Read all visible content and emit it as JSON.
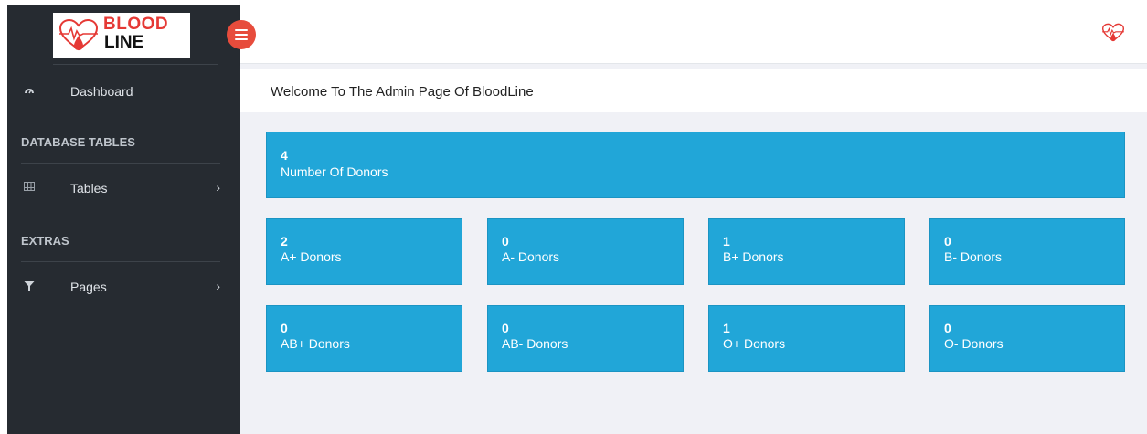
{
  "brand": {
    "line1": "BLOOD",
    "line2": "LINE"
  },
  "sidebar": {
    "dashboard": {
      "label": "Dashboard",
      "icon": "dashboard-icon"
    },
    "sections": [
      {
        "title": "DATABASE TABLES",
        "item": {
          "label": "Tables",
          "icon": "table-icon"
        }
      },
      {
        "title": "EXTRAS",
        "item": {
          "label": "Pages",
          "icon": "funnel-icon"
        }
      }
    ]
  },
  "header": {
    "welcome": "Welcome To The Admin Page Of BloodLine"
  },
  "summary": {
    "value": "4",
    "label": "Number Of Donors"
  },
  "blood_groups": [
    {
      "value": "2",
      "label": "A+ Donors"
    },
    {
      "value": "0",
      "label": "A- Donors"
    },
    {
      "value": "1",
      "label": "B+ Donors"
    },
    {
      "value": "0",
      "label": "B- Donors"
    },
    {
      "value": "0",
      "label": "AB+ Donors"
    },
    {
      "value": "0",
      "label": "AB- Donors"
    },
    {
      "value": "1",
      "label": "O+ Donors"
    },
    {
      "value": "0",
      "label": "O- Donors"
    }
  ],
  "colors": {
    "sidebar": "#262b31",
    "accent": "#21a6d8",
    "toggle": "#e74c3c",
    "main_bg": "#f0f1f6"
  }
}
